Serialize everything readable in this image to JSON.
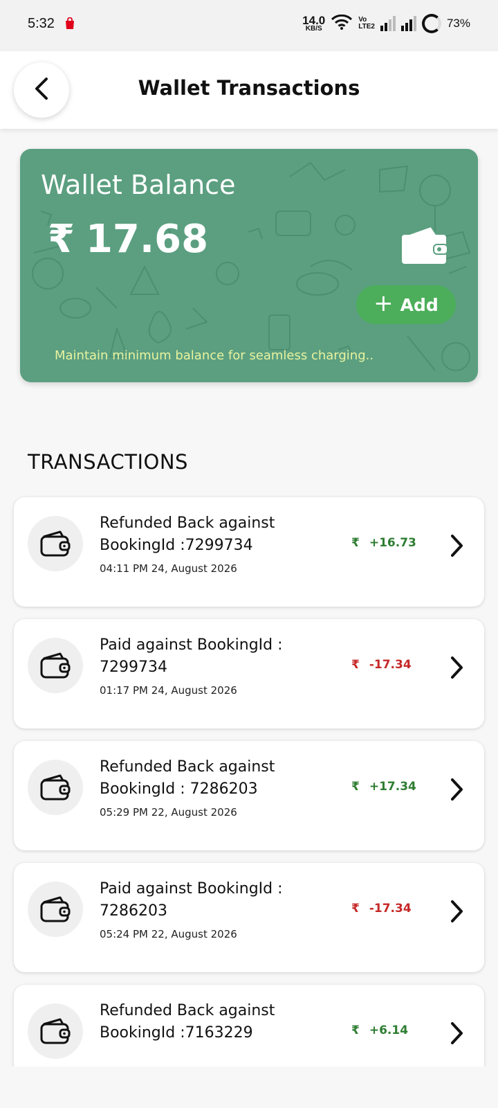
{
  "status_bar": {
    "time": "5:32",
    "net_speed_value": "14.0",
    "net_speed_unit": "KB/S",
    "volte_top": "Vo",
    "volte_bottom": "LTE2",
    "battery": "73%"
  },
  "header": {
    "title": "Wallet Transactions",
    "back_icon": "chevron-left-icon"
  },
  "wallet": {
    "title": "Wallet Balance",
    "currency": "₹",
    "balance": "17.68",
    "add_label": "Add",
    "note": "Maintain minimum balance for seamless charging..",
    "card_color": "#5b9f80",
    "add_color": "#4cae5a"
  },
  "transactions": {
    "heading": "TRANSACTIONS",
    "items": [
      {
        "line1": "Refunded Back against",
        "line2": "BookingId :7299734",
        "time": "04:11 PM 24, August 2026",
        "currency": "₹",
        "amount": "+16.73",
        "type": "credit"
      },
      {
        "line1": "Paid against BookingId :",
        "line2": "7299734",
        "time": "01:17 PM 24, August 2026",
        "currency": "₹",
        "amount": "-17.34",
        "type": "debit"
      },
      {
        "line1": "Refunded Back against",
        "line2": "BookingId : 7286203",
        "time": "05:29 PM 22, August 2026",
        "currency": "₹",
        "amount": "+17.34",
        "type": "credit"
      },
      {
        "line1": "Paid against BookingId :",
        "line2": "7286203",
        "time": "05:24 PM 22, August 2026",
        "currency": "₹",
        "amount": "-17.34",
        "type": "debit"
      },
      {
        "line1": "Refunded Back against",
        "line2": "BookingId :7163229",
        "time": "",
        "currency": "₹",
        "amount": "+6.14",
        "type": "credit"
      }
    ],
    "credit_color": "#2e7d32",
    "debit_color": "#c62828"
  }
}
